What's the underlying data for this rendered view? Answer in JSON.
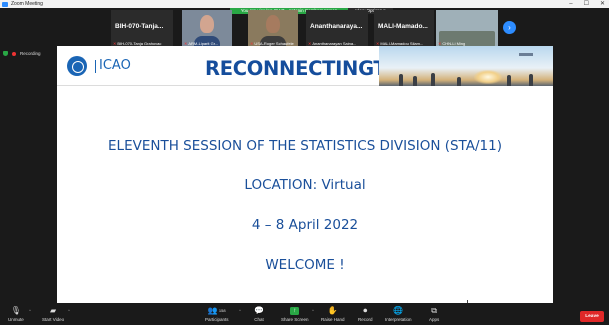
{
  "window": {
    "title": "Zoom Meeting",
    "minimize": "–",
    "maximize": "☐",
    "close": "✕"
  },
  "banner": {
    "viewing": "You are viewing ICAO - Antonin Combes' screen",
    "options": "View Options ▾"
  },
  "thumbnails": [
    {
      "bigname": "BIH-070-Tanja...",
      "caption": "BIH-070-Tanja Grahovac",
      "video": false
    },
    {
      "bigname": "",
      "caption": "ARM-Liparit Gr...",
      "video": true
    },
    {
      "bigname": "",
      "caption": "USA-Roger Schaufele",
      "video": true
    },
    {
      "bigname": "Ananthanaraya...",
      "caption": "Ananthanarayan Saina...",
      "video": false
    },
    {
      "bigname": "MALI-Mamado...",
      "caption": "MALI-Mamadou Silam...",
      "video": false
    },
    {
      "bigname": "",
      "caption": "CHN-Li Ming",
      "video": true
    }
  ],
  "recording": {
    "label": "Recording"
  },
  "slide": {
    "logo_text": "ICAO",
    "headline": "RECONNECTINGTHEWORLD",
    "lines": [
      "ELEVENTH SESSION OF THE STATISTICS DIVISION (STA/11)",
      "LOCATION: Virtual",
      "4 – 8 April 2022",
      "WELCOME !"
    ]
  },
  "toolbar": {
    "unmute": "Unmute",
    "start_video": "Start Video",
    "participants": "Participants",
    "participants_count": "158",
    "chat": "Chat",
    "share_screen": "Share Screen",
    "raise_hand": "Raise Hand",
    "record": "Record",
    "interpretation": "Interpretation",
    "apps": "Apps",
    "leave": "Leave"
  },
  "colors": {
    "accent": "#2d8cff",
    "share_green": "#29a745",
    "leave_red": "#e02828",
    "slide_text": "#1a4f9a"
  }
}
